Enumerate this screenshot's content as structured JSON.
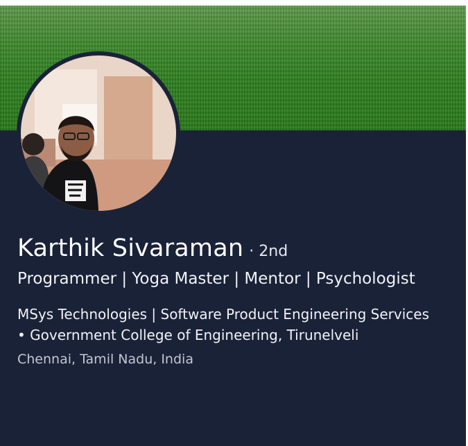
{
  "profile": {
    "name": "Karthik Sivaraman",
    "degree": "· 2nd",
    "headline": "Programmer |  Yoga Master |  Mentor | Psychologist",
    "company_education": "MSys Technologies | Software Product Engineering Services • Government College of Engineering, Tirunelveli",
    "location": "Chennai, Tamil Nadu, India"
  },
  "colors": {
    "card_background": "#1a2238",
    "banner_grass": "#2f7f20",
    "text_primary": "#ffffff",
    "text_secondary": "#c3c7d3"
  }
}
